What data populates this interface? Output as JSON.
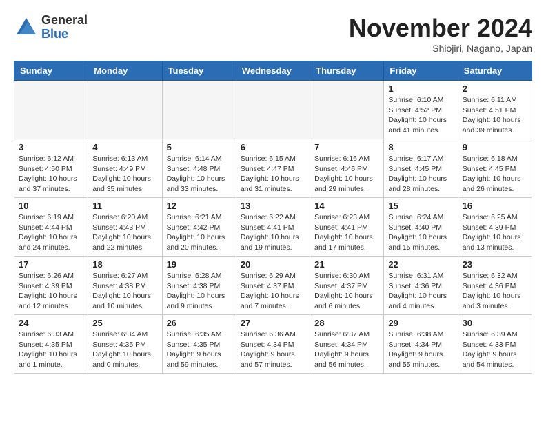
{
  "header": {
    "logo_general": "General",
    "logo_blue": "Blue",
    "month_title": "November 2024",
    "subtitle": "Shiojiri, Nagano, Japan"
  },
  "weekdays": [
    "Sunday",
    "Monday",
    "Tuesday",
    "Wednesday",
    "Thursday",
    "Friday",
    "Saturday"
  ],
  "weeks": [
    [
      {
        "day": "",
        "info": ""
      },
      {
        "day": "",
        "info": ""
      },
      {
        "day": "",
        "info": ""
      },
      {
        "day": "",
        "info": ""
      },
      {
        "day": "",
        "info": ""
      },
      {
        "day": "1",
        "info": "Sunrise: 6:10 AM\nSunset: 4:52 PM\nDaylight: 10 hours\nand 41 minutes."
      },
      {
        "day": "2",
        "info": "Sunrise: 6:11 AM\nSunset: 4:51 PM\nDaylight: 10 hours\nand 39 minutes."
      }
    ],
    [
      {
        "day": "3",
        "info": "Sunrise: 6:12 AM\nSunset: 4:50 PM\nDaylight: 10 hours\nand 37 minutes."
      },
      {
        "day": "4",
        "info": "Sunrise: 6:13 AM\nSunset: 4:49 PM\nDaylight: 10 hours\nand 35 minutes."
      },
      {
        "day": "5",
        "info": "Sunrise: 6:14 AM\nSunset: 4:48 PM\nDaylight: 10 hours\nand 33 minutes."
      },
      {
        "day": "6",
        "info": "Sunrise: 6:15 AM\nSunset: 4:47 PM\nDaylight: 10 hours\nand 31 minutes."
      },
      {
        "day": "7",
        "info": "Sunrise: 6:16 AM\nSunset: 4:46 PM\nDaylight: 10 hours\nand 29 minutes."
      },
      {
        "day": "8",
        "info": "Sunrise: 6:17 AM\nSunset: 4:45 PM\nDaylight: 10 hours\nand 28 minutes."
      },
      {
        "day": "9",
        "info": "Sunrise: 6:18 AM\nSunset: 4:45 PM\nDaylight: 10 hours\nand 26 minutes."
      }
    ],
    [
      {
        "day": "10",
        "info": "Sunrise: 6:19 AM\nSunset: 4:44 PM\nDaylight: 10 hours\nand 24 minutes."
      },
      {
        "day": "11",
        "info": "Sunrise: 6:20 AM\nSunset: 4:43 PM\nDaylight: 10 hours\nand 22 minutes."
      },
      {
        "day": "12",
        "info": "Sunrise: 6:21 AM\nSunset: 4:42 PM\nDaylight: 10 hours\nand 20 minutes."
      },
      {
        "day": "13",
        "info": "Sunrise: 6:22 AM\nSunset: 4:41 PM\nDaylight: 10 hours\nand 19 minutes."
      },
      {
        "day": "14",
        "info": "Sunrise: 6:23 AM\nSunset: 4:41 PM\nDaylight: 10 hours\nand 17 minutes."
      },
      {
        "day": "15",
        "info": "Sunrise: 6:24 AM\nSunset: 4:40 PM\nDaylight: 10 hours\nand 15 minutes."
      },
      {
        "day": "16",
        "info": "Sunrise: 6:25 AM\nSunset: 4:39 PM\nDaylight: 10 hours\nand 13 minutes."
      }
    ],
    [
      {
        "day": "17",
        "info": "Sunrise: 6:26 AM\nSunset: 4:39 PM\nDaylight: 10 hours\nand 12 minutes."
      },
      {
        "day": "18",
        "info": "Sunrise: 6:27 AM\nSunset: 4:38 PM\nDaylight: 10 hours\nand 10 minutes."
      },
      {
        "day": "19",
        "info": "Sunrise: 6:28 AM\nSunset: 4:38 PM\nDaylight: 10 hours\nand 9 minutes."
      },
      {
        "day": "20",
        "info": "Sunrise: 6:29 AM\nSunset: 4:37 PM\nDaylight: 10 hours\nand 7 minutes."
      },
      {
        "day": "21",
        "info": "Sunrise: 6:30 AM\nSunset: 4:37 PM\nDaylight: 10 hours\nand 6 minutes."
      },
      {
        "day": "22",
        "info": "Sunrise: 6:31 AM\nSunset: 4:36 PM\nDaylight: 10 hours\nand 4 minutes."
      },
      {
        "day": "23",
        "info": "Sunrise: 6:32 AM\nSunset: 4:36 PM\nDaylight: 10 hours\nand 3 minutes."
      }
    ],
    [
      {
        "day": "24",
        "info": "Sunrise: 6:33 AM\nSunset: 4:35 PM\nDaylight: 10 hours\nand 1 minute."
      },
      {
        "day": "25",
        "info": "Sunrise: 6:34 AM\nSunset: 4:35 PM\nDaylight: 10 hours\nand 0 minutes."
      },
      {
        "day": "26",
        "info": "Sunrise: 6:35 AM\nSunset: 4:35 PM\nDaylight: 9 hours\nand 59 minutes."
      },
      {
        "day": "27",
        "info": "Sunrise: 6:36 AM\nSunset: 4:34 PM\nDaylight: 9 hours\nand 57 minutes."
      },
      {
        "day": "28",
        "info": "Sunrise: 6:37 AM\nSunset: 4:34 PM\nDaylight: 9 hours\nand 56 minutes."
      },
      {
        "day": "29",
        "info": "Sunrise: 6:38 AM\nSunset: 4:34 PM\nDaylight: 9 hours\nand 55 minutes."
      },
      {
        "day": "30",
        "info": "Sunrise: 6:39 AM\nSunset: 4:33 PM\nDaylight: 9 hours\nand 54 minutes."
      }
    ]
  ]
}
